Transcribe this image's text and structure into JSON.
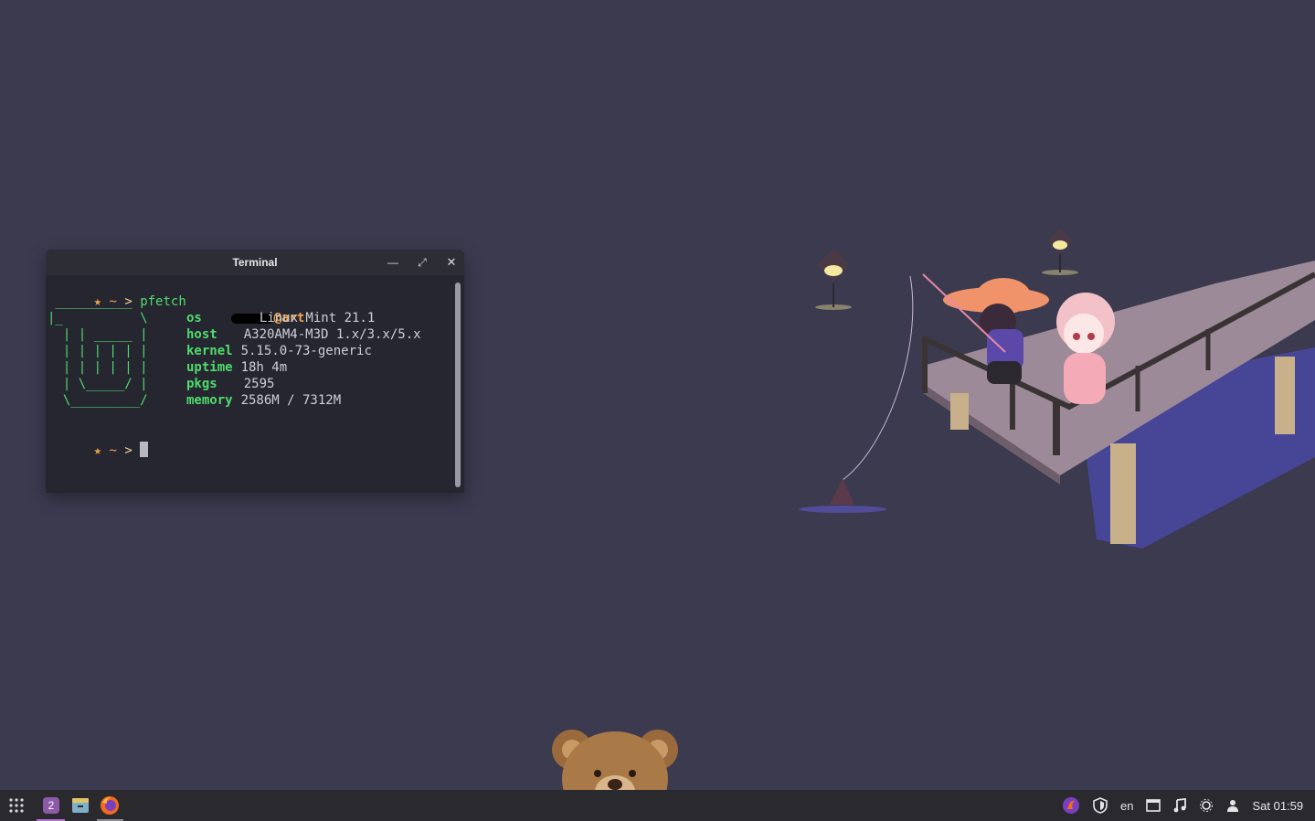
{
  "terminal": {
    "title": "Terminal",
    "prompt": {
      "star": "★",
      "dir": "~",
      "arrow": ">"
    },
    "command": "pfetch",
    "logo": [
      " __________",
      "|_          \\",
      "  | | _____ |",
      "  | | | | | |",
      "  | | | | | |",
      "  | \\_____/ |",
      "  \\_________/"
    ],
    "userhost": "@art",
    "info": [
      {
        "key": "os",
        "value": "Linux Mint 21.1"
      },
      {
        "key": "host",
        "value": "A320AM4-M3D 1.x/3.x/5.x"
      },
      {
        "key": "kernel",
        "value": "5.15.0-73-generic"
      },
      {
        "key": "uptime",
        "value": "18h 4m"
      },
      {
        "key": "pkgs",
        "value": "2595"
      },
      {
        "key": "memory",
        "value": "2586M / 7312M"
      }
    ]
  },
  "taskbar": {
    "workspace": "2",
    "keyboard_layout": "en",
    "clock": "Sat 01:59"
  }
}
